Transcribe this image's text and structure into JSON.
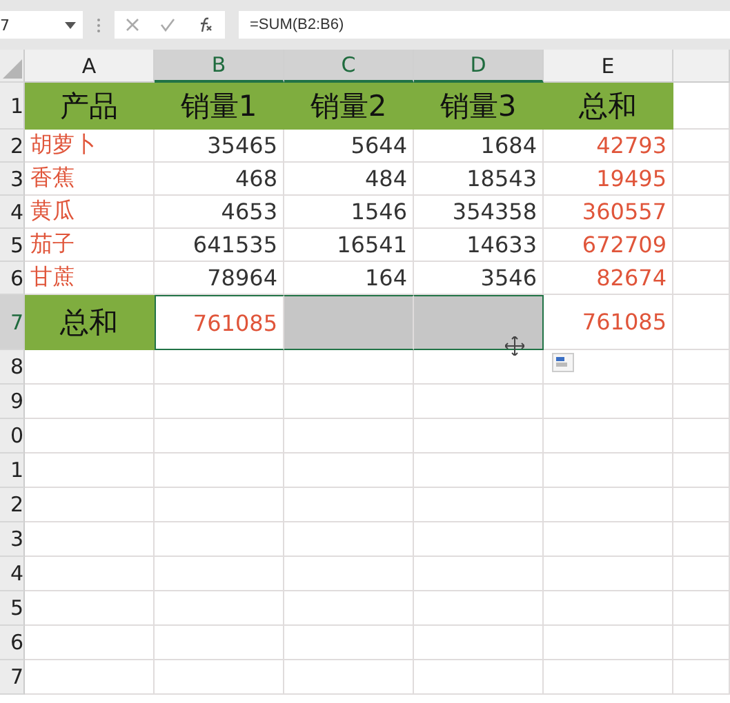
{
  "name_box": {
    "value": "7"
  },
  "formula_bar": {
    "value": "=SUM(B2:B6)"
  },
  "columns": [
    {
      "label": "A",
      "selected": false
    },
    {
      "label": "B",
      "selected": true
    },
    {
      "label": "C",
      "selected": true
    },
    {
      "label": "D",
      "selected": true
    },
    {
      "label": "E",
      "selected": false
    }
  ],
  "rows": [
    {
      "number": "1",
      "selected": false,
      "kind": "header",
      "cells": [
        {
          "text": "产品",
          "selected": false
        },
        {
          "text": "销量1",
          "selected": false
        },
        {
          "text": "销量2",
          "selected": false
        },
        {
          "text": "销量3",
          "selected": false
        },
        {
          "text": "总和",
          "selected": false
        }
      ]
    },
    {
      "number": "2",
      "selected": false,
      "kind": "data",
      "cells": [
        {
          "text": "胡萝卜",
          "selected": false
        },
        {
          "text": "35465",
          "selected": false
        },
        {
          "text": "5644",
          "selected": false
        },
        {
          "text": "1684",
          "selected": false
        },
        {
          "text": "42793",
          "selected": false
        }
      ]
    },
    {
      "number": "3",
      "selected": false,
      "kind": "data",
      "cells": [
        {
          "text": "香蕉",
          "selected": false
        },
        {
          "text": "468",
          "selected": false
        },
        {
          "text": "484",
          "selected": false
        },
        {
          "text": "18543",
          "selected": false
        },
        {
          "text": "19495",
          "selected": false
        }
      ]
    },
    {
      "number": "4",
      "selected": false,
      "kind": "data",
      "cells": [
        {
          "text": "黄瓜",
          "selected": false
        },
        {
          "text": "4653",
          "selected": false
        },
        {
          "text": "1546",
          "selected": false
        },
        {
          "text": "354358",
          "selected": false
        },
        {
          "text": "360557",
          "selected": false
        }
      ]
    },
    {
      "number": "5",
      "selected": false,
      "kind": "data",
      "cells": [
        {
          "text": "茄子",
          "selected": false
        },
        {
          "text": "641535",
          "selected": false
        },
        {
          "text": "16541",
          "selected": false
        },
        {
          "text": "14633",
          "selected": false
        },
        {
          "text": "672709",
          "selected": false
        }
      ]
    },
    {
      "number": "6",
      "selected": false,
      "kind": "data",
      "cells": [
        {
          "text": "甘蔗",
          "selected": false
        },
        {
          "text": "78964",
          "selected": false
        },
        {
          "text": "164",
          "selected": false
        },
        {
          "text": "3546",
          "selected": false
        },
        {
          "text": "82674",
          "selected": false
        }
      ]
    },
    {
      "number": "7",
      "selected": true,
      "kind": "total",
      "cells": [
        {
          "text": "总和",
          "selected": false
        },
        {
          "text": "761085",
          "selected": true
        },
        {
          "selected": true
        },
        {
          "selected": true
        },
        {
          "text": "761085",
          "selected": false
        }
      ]
    },
    {
      "number": "8",
      "selected": false,
      "kind": "empty"
    },
    {
      "number": "9",
      "selected": false,
      "kind": "empty"
    },
    {
      "number": "0",
      "selected": false,
      "kind": "empty"
    },
    {
      "number": "1",
      "selected": false,
      "kind": "empty"
    },
    {
      "number": "2",
      "selected": false,
      "kind": "empty"
    },
    {
      "number": "3",
      "selected": false,
      "kind": "empty"
    },
    {
      "number": "4",
      "selected": false,
      "kind": "empty"
    },
    {
      "number": "5",
      "selected": false,
      "kind": "empty"
    },
    {
      "number": "6",
      "selected": false,
      "kind": "empty"
    },
    {
      "number": "7",
      "selected": false,
      "kind": "empty"
    }
  ]
}
